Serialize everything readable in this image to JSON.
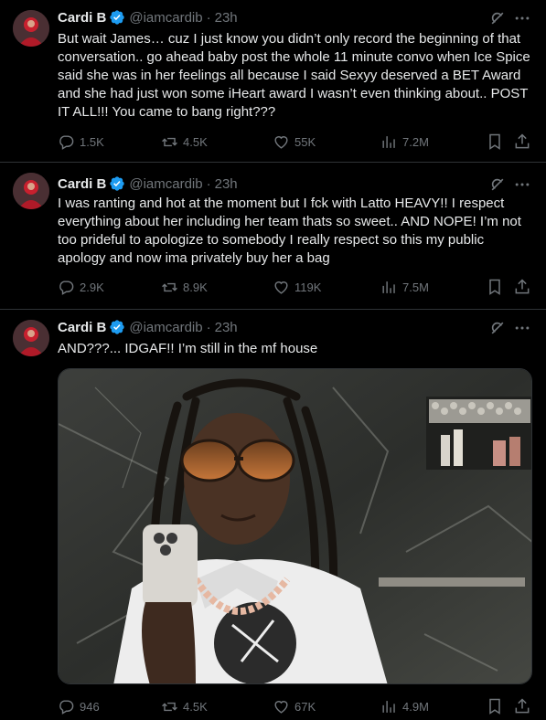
{
  "tweets": [
    {
      "name": "Cardi B",
      "handle": "@iamcardib",
      "separator": "·",
      "time": "23h",
      "text": "But wait James… cuz I just know you didn’t only record the beginning of that conversation.. go ahead baby post the whole 11 minute convo when Ice Spice said she was in her feelings all because I said Sexyy deserved a BET Award and she had just won some iHeart award I wasn’t even thinking about.. POST IT ALL!!! You came to bang right???",
      "replies": "1.5K",
      "reposts": "4.5K",
      "likes": "55K",
      "views": "7.2M"
    },
    {
      "name": "Cardi B",
      "handle": "@iamcardib",
      "separator": "·",
      "time": "23h",
      "text": "I was ranting and hot at the moment but I fck with Latto HEAVY!! I respect everything about her including her team thats so sweet.. AND NOPE! I’m not too prideful to apologize to somebody I really respect so this my public apology and now ima privately buy her a bag",
      "replies": "2.9K",
      "reposts": "8.9K",
      "likes": "119K",
      "views": "7.5M"
    },
    {
      "name": "Cardi B",
      "handle": "@iamcardib",
      "separator": "·",
      "time": "23h",
      "text": "AND???... IDGAF!! I’m still in the mf house",
      "replies": "946",
      "reposts": "4.5K",
      "likes": "67K",
      "views": "4.9M",
      "media": "photo of a man with long braids and orange-tinted sunglasses taking a mirror selfie with a phone in a dark marble bathroom"
    }
  ],
  "colors": {
    "background": "#000000",
    "text": "#e7e9ea",
    "muted": "#71767b",
    "verified": "#1d9bf0",
    "divider": "#2f3336"
  },
  "icons": [
    "verified-badge-icon",
    "grok-icon",
    "more-icon",
    "reply-icon",
    "repost-icon",
    "like-icon",
    "views-icon",
    "bookmark-icon",
    "share-icon"
  ]
}
